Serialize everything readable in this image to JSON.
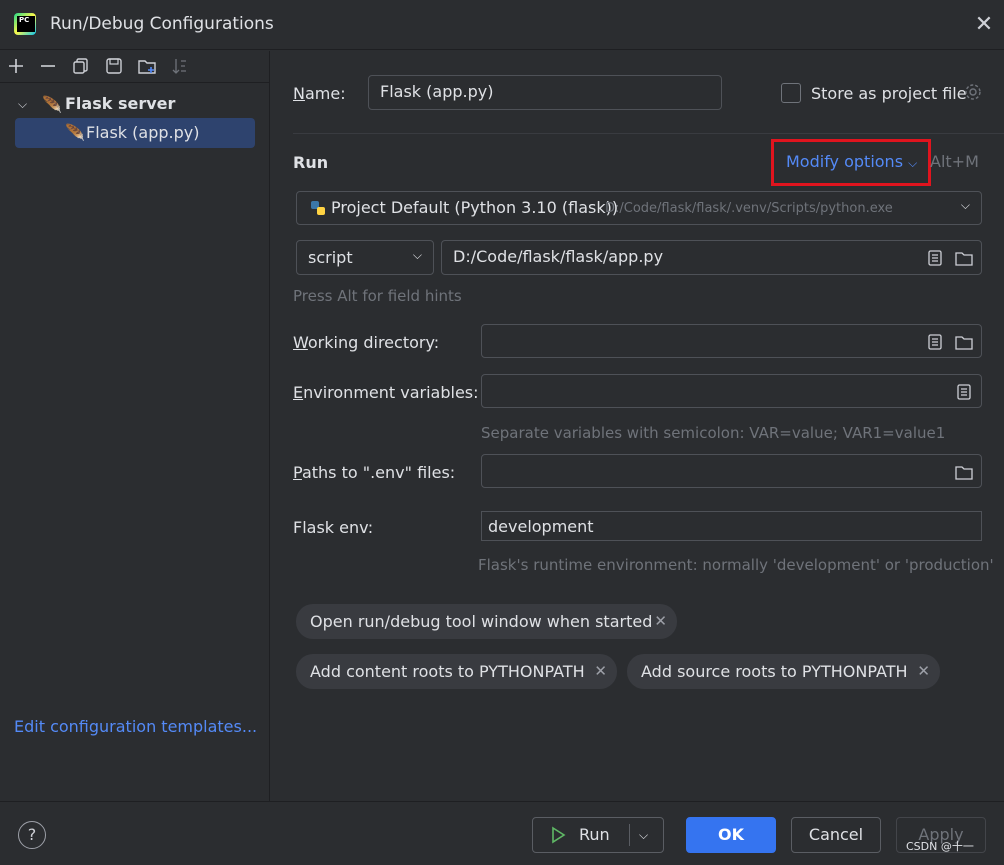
{
  "window": {
    "title": "Run/Debug Configurations"
  },
  "toolbar": {
    "icons": [
      "add-icon",
      "remove-icon",
      "copy-icon",
      "save-icon",
      "new-folder-icon",
      "sort-icon"
    ]
  },
  "tree": {
    "group_label": "Flask server",
    "item_label": "Flask (app.py)"
  },
  "sidebar": {
    "edit_templates": "Edit configuration templates..."
  },
  "form": {
    "name_label_u": "N",
    "name_label_rest": "ame:",
    "name_value": "Flask (app.py)",
    "store_label": "Store as project file",
    "run_title": "Run",
    "modify_options": "Modify options",
    "modify_shortcut": "Alt+M",
    "interpreter_name": "Project Default (Python 3.10 (flask))",
    "interpreter_path": "D:/Code/flask/flask/.venv/Scripts/python.exe",
    "script_type": "script",
    "script_path": "D:/Code/flask/flask/app.py",
    "field_hint": "Press Alt for field hints",
    "workdir_label_u": "W",
    "workdir_label_rest": "orking directory:",
    "env_label_u": "E",
    "env_label_rest": "nvironment variables:",
    "env_hint": "Separate variables with semicolon: VAR=value; VAR1=value1",
    "dotenv_label_u": "P",
    "dotenv_label_rest": "aths to \".env\" files:",
    "flask_env_label": "Flask env:",
    "flask_env_value": "development",
    "flask_env_hint": "Flask's runtime environment: normally 'development' or 'production'"
  },
  "chips": [
    "Open run/debug tool window when started",
    "Add content roots to PYTHONPATH",
    "Add source roots to PYTHONPATH"
  ],
  "footer": {
    "help": "?",
    "run": "Run",
    "ok": "OK",
    "cancel": "Cancel",
    "apply": "Apply"
  },
  "watermark": "CSDN @十一",
  "colors": {
    "accent": "#3574f0",
    "link": "#548af7",
    "highlight_box": "#e0141e",
    "selection": "#2e436e"
  }
}
